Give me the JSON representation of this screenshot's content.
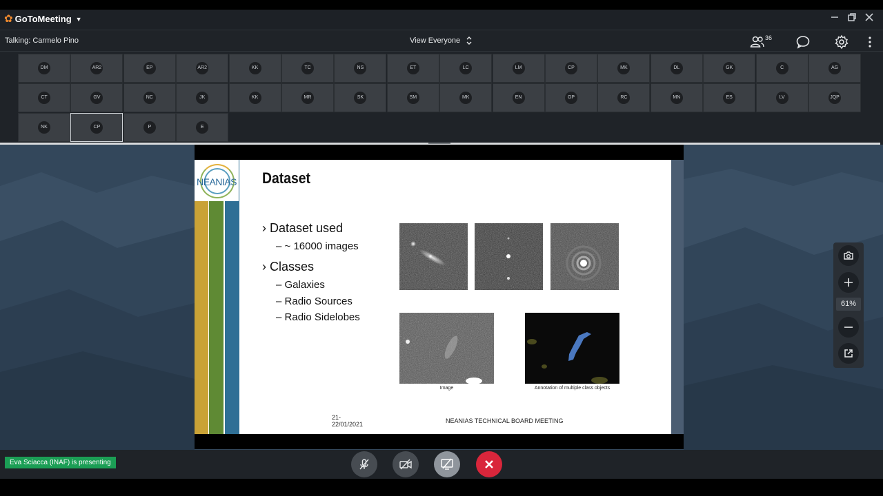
{
  "app": {
    "brand": "GoToMeeting",
    "window_controls": [
      "minimize",
      "restore",
      "close"
    ]
  },
  "toolbar": {
    "talking": "Talking: Carmelo Pino",
    "view_selector": "View Everyone",
    "attendee_count": "36",
    "icons": [
      "attendees-icon",
      "chat-icon",
      "settings-gear-icon",
      "more-vertical-icon"
    ]
  },
  "participants": [
    "DM",
    "AR2",
    "EP",
    "AR2",
    "KK",
    "TC",
    "NS",
    "ET",
    "LC",
    "LM",
    "CP",
    "MK",
    "DL",
    "GK",
    "C",
    "AG",
    "CT",
    "GV",
    "NC",
    "JK",
    "KK",
    "MR",
    "SK",
    "SM",
    "MK",
    "EN",
    "GP",
    "RC",
    "MN",
    "ES",
    "LV",
    "JQP",
    "NK",
    "CP",
    "P",
    "E"
  ],
  "active_participant_index": 33,
  "slide": {
    "logo_text": "NEANIAS",
    "title": "Dataset",
    "bullets": [
      {
        "text": "Dataset used",
        "sub": [
          "~ 16000 images"
        ]
      },
      {
        "text": "Classes",
        "sub": [
          "Galaxies",
          "Radio Sources",
          "Radio Sidelobes"
        ]
      }
    ],
    "caption_image": "Image",
    "caption_annotation": "Annotation of multiple class objects",
    "date_line1": "21-",
    "date_line2": "22/01/2021",
    "footer": "NEANIAS TECHNICAL BOARD MEETING",
    "stripe_colors": [
      "#c9a236",
      "#5f8a34",
      "#2f6f95"
    ]
  },
  "zoom": {
    "level": "61%",
    "icons": [
      "camera-icon",
      "zoom-in-icon",
      "zoom-out-icon",
      "popout-icon"
    ]
  },
  "bottombar": {
    "presenting": "Eva Sciacca (INAF) is presenting",
    "controls": [
      "mic-muted-icon",
      "camera-off-icon",
      "screen-share-off-icon",
      "end-call-icon"
    ],
    "end_call_color": "#d9263b"
  }
}
